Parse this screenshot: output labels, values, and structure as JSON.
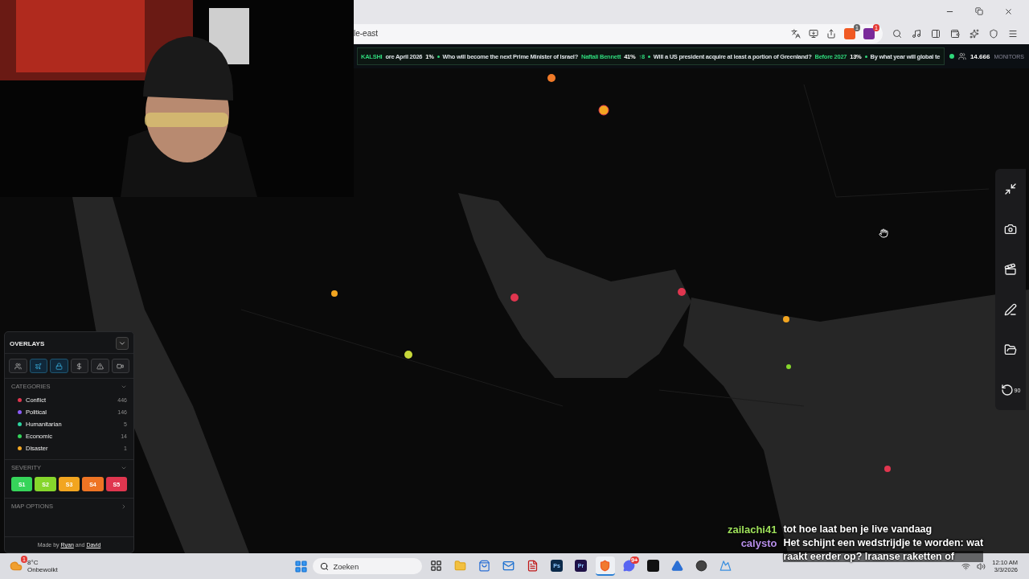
{
  "browser": {
    "address": "le-east",
    "extension_badges": [
      "1",
      "1"
    ]
  },
  "ticker": {
    "source": "KALSHI",
    "items": [
      {
        "question": "ore April 2026",
        "percent": "1%"
      },
      {
        "question": "Who will become the next Prime Minister of Israel?",
        "answer": "Naftali Bennett",
        "percent": "41%",
        "change": "↑8"
      },
      {
        "question": "Will a US president acquire at least a portion of Greenland?",
        "answer": "Before 2027",
        "percent": "13%"
      },
      {
        "question": "By what year will global te"
      }
    ]
  },
  "monitors": {
    "count": "14.666",
    "label": "MONITORS"
  },
  "overlays_panel": {
    "title": "OVERLAYS",
    "toggles": [
      {
        "kind": "people",
        "selected": false
      },
      {
        "kind": "plane",
        "selected": true
      },
      {
        "kind": "lock",
        "selected": true
      },
      {
        "kind": "dollar",
        "selected": false
      },
      {
        "kind": "alert",
        "selected": false
      },
      {
        "kind": "video",
        "selected": false
      }
    ],
    "categories_title": "CATEGORIES",
    "categories": [
      {
        "label": "Conflict",
        "count": "446",
        "color": "#e0364f"
      },
      {
        "label": "Political",
        "count": "146",
        "color": "#8b5cf6"
      },
      {
        "label": "Humanitarian",
        "count": "5",
        "color": "#2dd4a0"
      },
      {
        "label": "Economic",
        "count": "14",
        "color": "#34d35a"
      },
      {
        "label": "Disaster",
        "count": "1",
        "color": "#f4a824"
      }
    ],
    "severity_title": "SEVERITY",
    "severity": [
      {
        "label": "S1",
        "color": "#36d45a"
      },
      {
        "label": "S2",
        "color": "#86d62c"
      },
      {
        "label": "S3",
        "color": "#f2a520"
      },
      {
        "label": "S4",
        "color": "#ee7424"
      },
      {
        "label": "S5",
        "color": "#e0364f"
      }
    ],
    "map_options": "MAP OPTIONS",
    "credit": {
      "prefix": "Made by",
      "first": "Ryan",
      "joiner": "and",
      "second": "David"
    }
  },
  "map_tools": [
    {
      "kind": "collapse"
    },
    {
      "kind": "camera"
    },
    {
      "kind": "video"
    },
    {
      "kind": "draw"
    },
    {
      "kind": "folder"
    },
    {
      "kind": "rotate",
      "label": "90"
    }
  ],
  "chat": [
    {
      "user": "zailachi41",
      "color": "#9ee05a",
      "lines": [
        "tot hoe laat ben je live vandaag"
      ]
    },
    {
      "user": "calysto",
      "color": "#b58de8",
      "lines": [
        "Het schijnt een wedstrijdje te worden: wat",
        "raakt eerder op? Iraanse raketten of"
      ]
    }
  ],
  "taskbar": {
    "weather": {
      "temp": "8°C",
      "condition": "Onbewolkt",
      "badge": "1"
    },
    "search": {
      "placeholder": "Zoeken"
    },
    "apps": [
      {
        "kind": "taskview",
        "selected": false
      },
      {
        "kind": "folder",
        "selected": false
      },
      {
        "kind": "store",
        "selected": false
      },
      {
        "kind": "mail",
        "selected": false
      },
      {
        "kind": "pdf",
        "selected": false
      },
      {
        "kind": "tile",
        "label": "Ps",
        "color": "#0b2a4a",
        "selected": false
      },
      {
        "kind": "tile",
        "label": "Pr",
        "color": "#1f1147",
        "selected": false
      },
      {
        "kind": "brave",
        "selected": true
      },
      {
        "kind": "chat",
        "badge": "9+",
        "selected": false
      },
      {
        "kind": "dark",
        "selected": false
      },
      {
        "kind": "arrow",
        "selected": false
      },
      {
        "kind": "record",
        "selected": false
      },
      {
        "kind": "mountain",
        "selected": false
      }
    ],
    "clock": {
      "time": "12:10 AM",
      "date": "3/3/2026"
    }
  }
}
